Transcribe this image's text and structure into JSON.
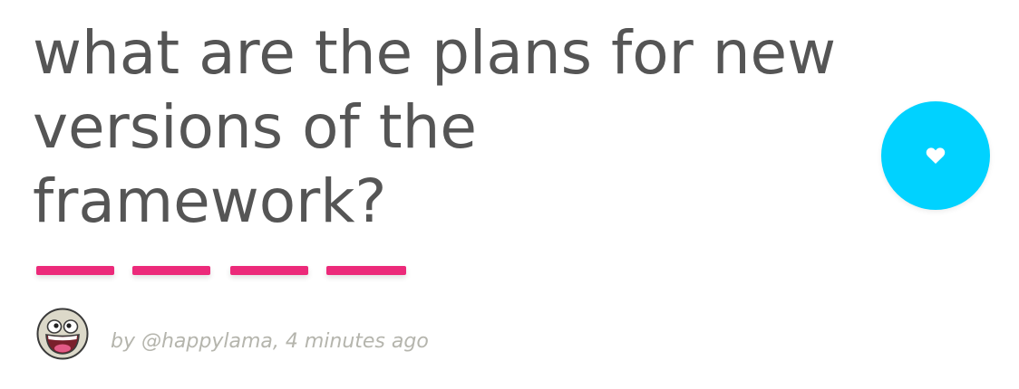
{
  "question": {
    "title": "what are the plans for new versions of the framework?"
  },
  "divider": {
    "color": "#ec2a7a",
    "count": 4
  },
  "like_button": {
    "icon": "heart-icon",
    "color": "#00d2ff",
    "icon_color": "#ffffff"
  },
  "author": {
    "avatar_icon": "awesome-face-avatar",
    "byline": "by @happylama, 4 minutes ago"
  }
}
